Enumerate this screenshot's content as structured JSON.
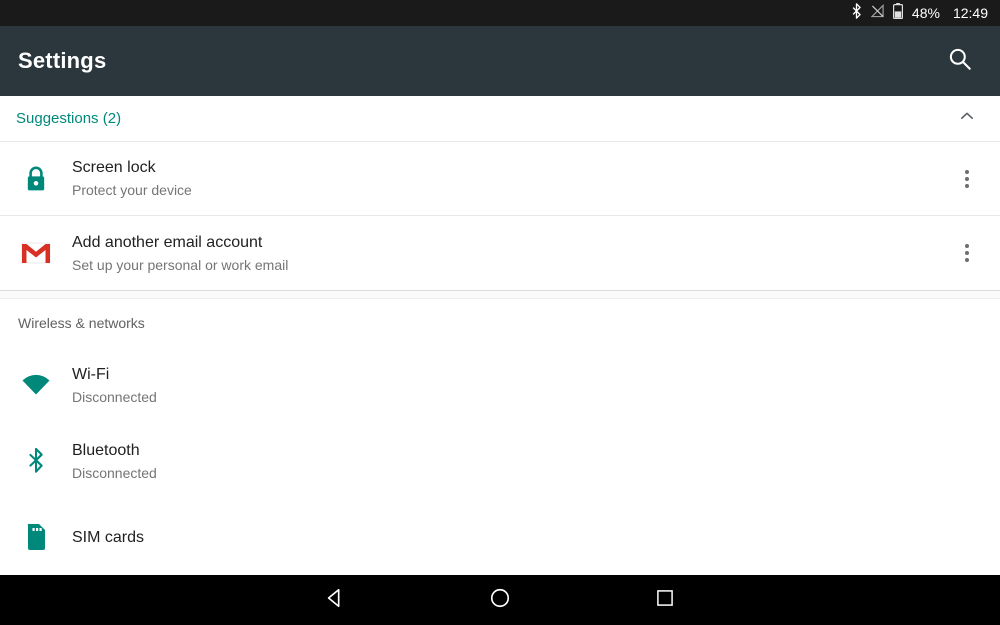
{
  "status_bar": {
    "icons": [
      "bluetooth-icon",
      "signal-off-icon",
      "battery-icon"
    ],
    "battery_percent": "48%",
    "time": "12:49"
  },
  "app_bar": {
    "title": "Settings",
    "search_icon": "search-icon"
  },
  "suggestions": {
    "title": "Suggestions (2)",
    "collapse_icon": "chevron-up-icon",
    "accent_color": "#00897b",
    "items": [
      {
        "icon": "lock-icon",
        "title": "Screen lock",
        "subtitle": "Protect your device",
        "overflow_icon": "more-vert-icon"
      },
      {
        "icon": "gmail-icon",
        "title": "Add another email account",
        "subtitle": "Set up your personal or work email",
        "overflow_icon": "more-vert-icon"
      }
    ]
  },
  "sections": [
    {
      "header": "Wireless & networks",
      "rows": [
        {
          "icon": "wifi-icon",
          "title": "Wi-Fi",
          "subtitle": "Disconnected"
        },
        {
          "icon": "bluetooth-icon",
          "title": "Bluetooth",
          "subtitle": "Disconnected"
        },
        {
          "icon": "sim-card-icon",
          "title": "SIM cards",
          "subtitle": ""
        }
      ]
    }
  ],
  "nav_bar": {
    "back": "back-triangle-icon",
    "home": "home-circle-icon",
    "recents": "recents-square-icon"
  },
  "colors": {
    "accent_teal": "#00897b",
    "app_bar": "#2b373d",
    "gmail_red": "#d93025"
  }
}
